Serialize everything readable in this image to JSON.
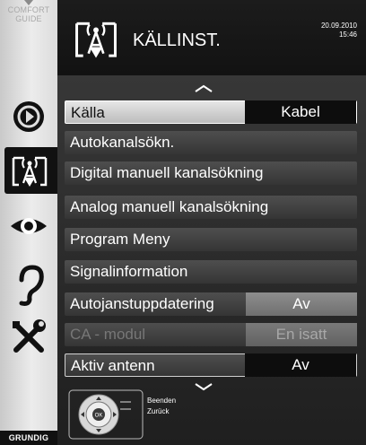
{
  "rail": {
    "comfort_line1": "COMFORT",
    "comfort_line2": "GUIDE",
    "brand": "GRUNDIG",
    "icons": [
      "play-circle-icon",
      "antenna-source-icon",
      "eye-icon",
      "ear-icon",
      "tools-icon"
    ]
  },
  "header": {
    "title": "KÄLLINST.",
    "date": "20.09.2010",
    "time": "15:46"
  },
  "menu": [
    {
      "label": "Källa",
      "value": "Kabel"
    },
    {
      "label": "Autokanalsökn."
    },
    {
      "label": "Digital manuell kanalsökning"
    },
    {
      "label": "Analog manuell kanalsökning"
    },
    {
      "label": "Program Meny"
    },
    {
      "label": "Signalinformation"
    },
    {
      "label": "Autojanstuppdatering",
      "value": "Av"
    },
    {
      "label": "CA - modul",
      "value": "En isatt"
    },
    {
      "label": "Aktiv antenn",
      "value": "Av"
    }
  ],
  "footer": {
    "ok_label": "OK",
    "hint_exit": "Beenden",
    "hint_back": "Zurück"
  }
}
